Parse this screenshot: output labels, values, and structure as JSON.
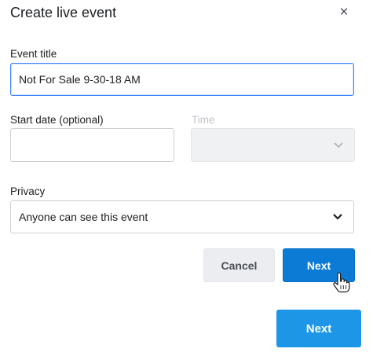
{
  "dialog": {
    "title": "Create live event",
    "close_symbol": "×"
  },
  "event_title": {
    "label": "Event title",
    "value": "Not For Sale 9-30-18 AM"
  },
  "start_date": {
    "label": "Start date (optional)",
    "value": ""
  },
  "time": {
    "label": "Time",
    "value": ""
  },
  "privacy": {
    "label": "Privacy",
    "value": "Anyone can see this event"
  },
  "buttons": {
    "cancel": "Cancel",
    "next": "Next",
    "next_secondary": "Next"
  },
  "colors": {
    "primary_blue": "#0c7bd6",
    "secondary_blue": "#1d96e8",
    "focus_border": "#4080ff"
  },
  "icons": [
    "close-icon",
    "chevron-down-icon",
    "hand-pointer-cursor-icon"
  ]
}
